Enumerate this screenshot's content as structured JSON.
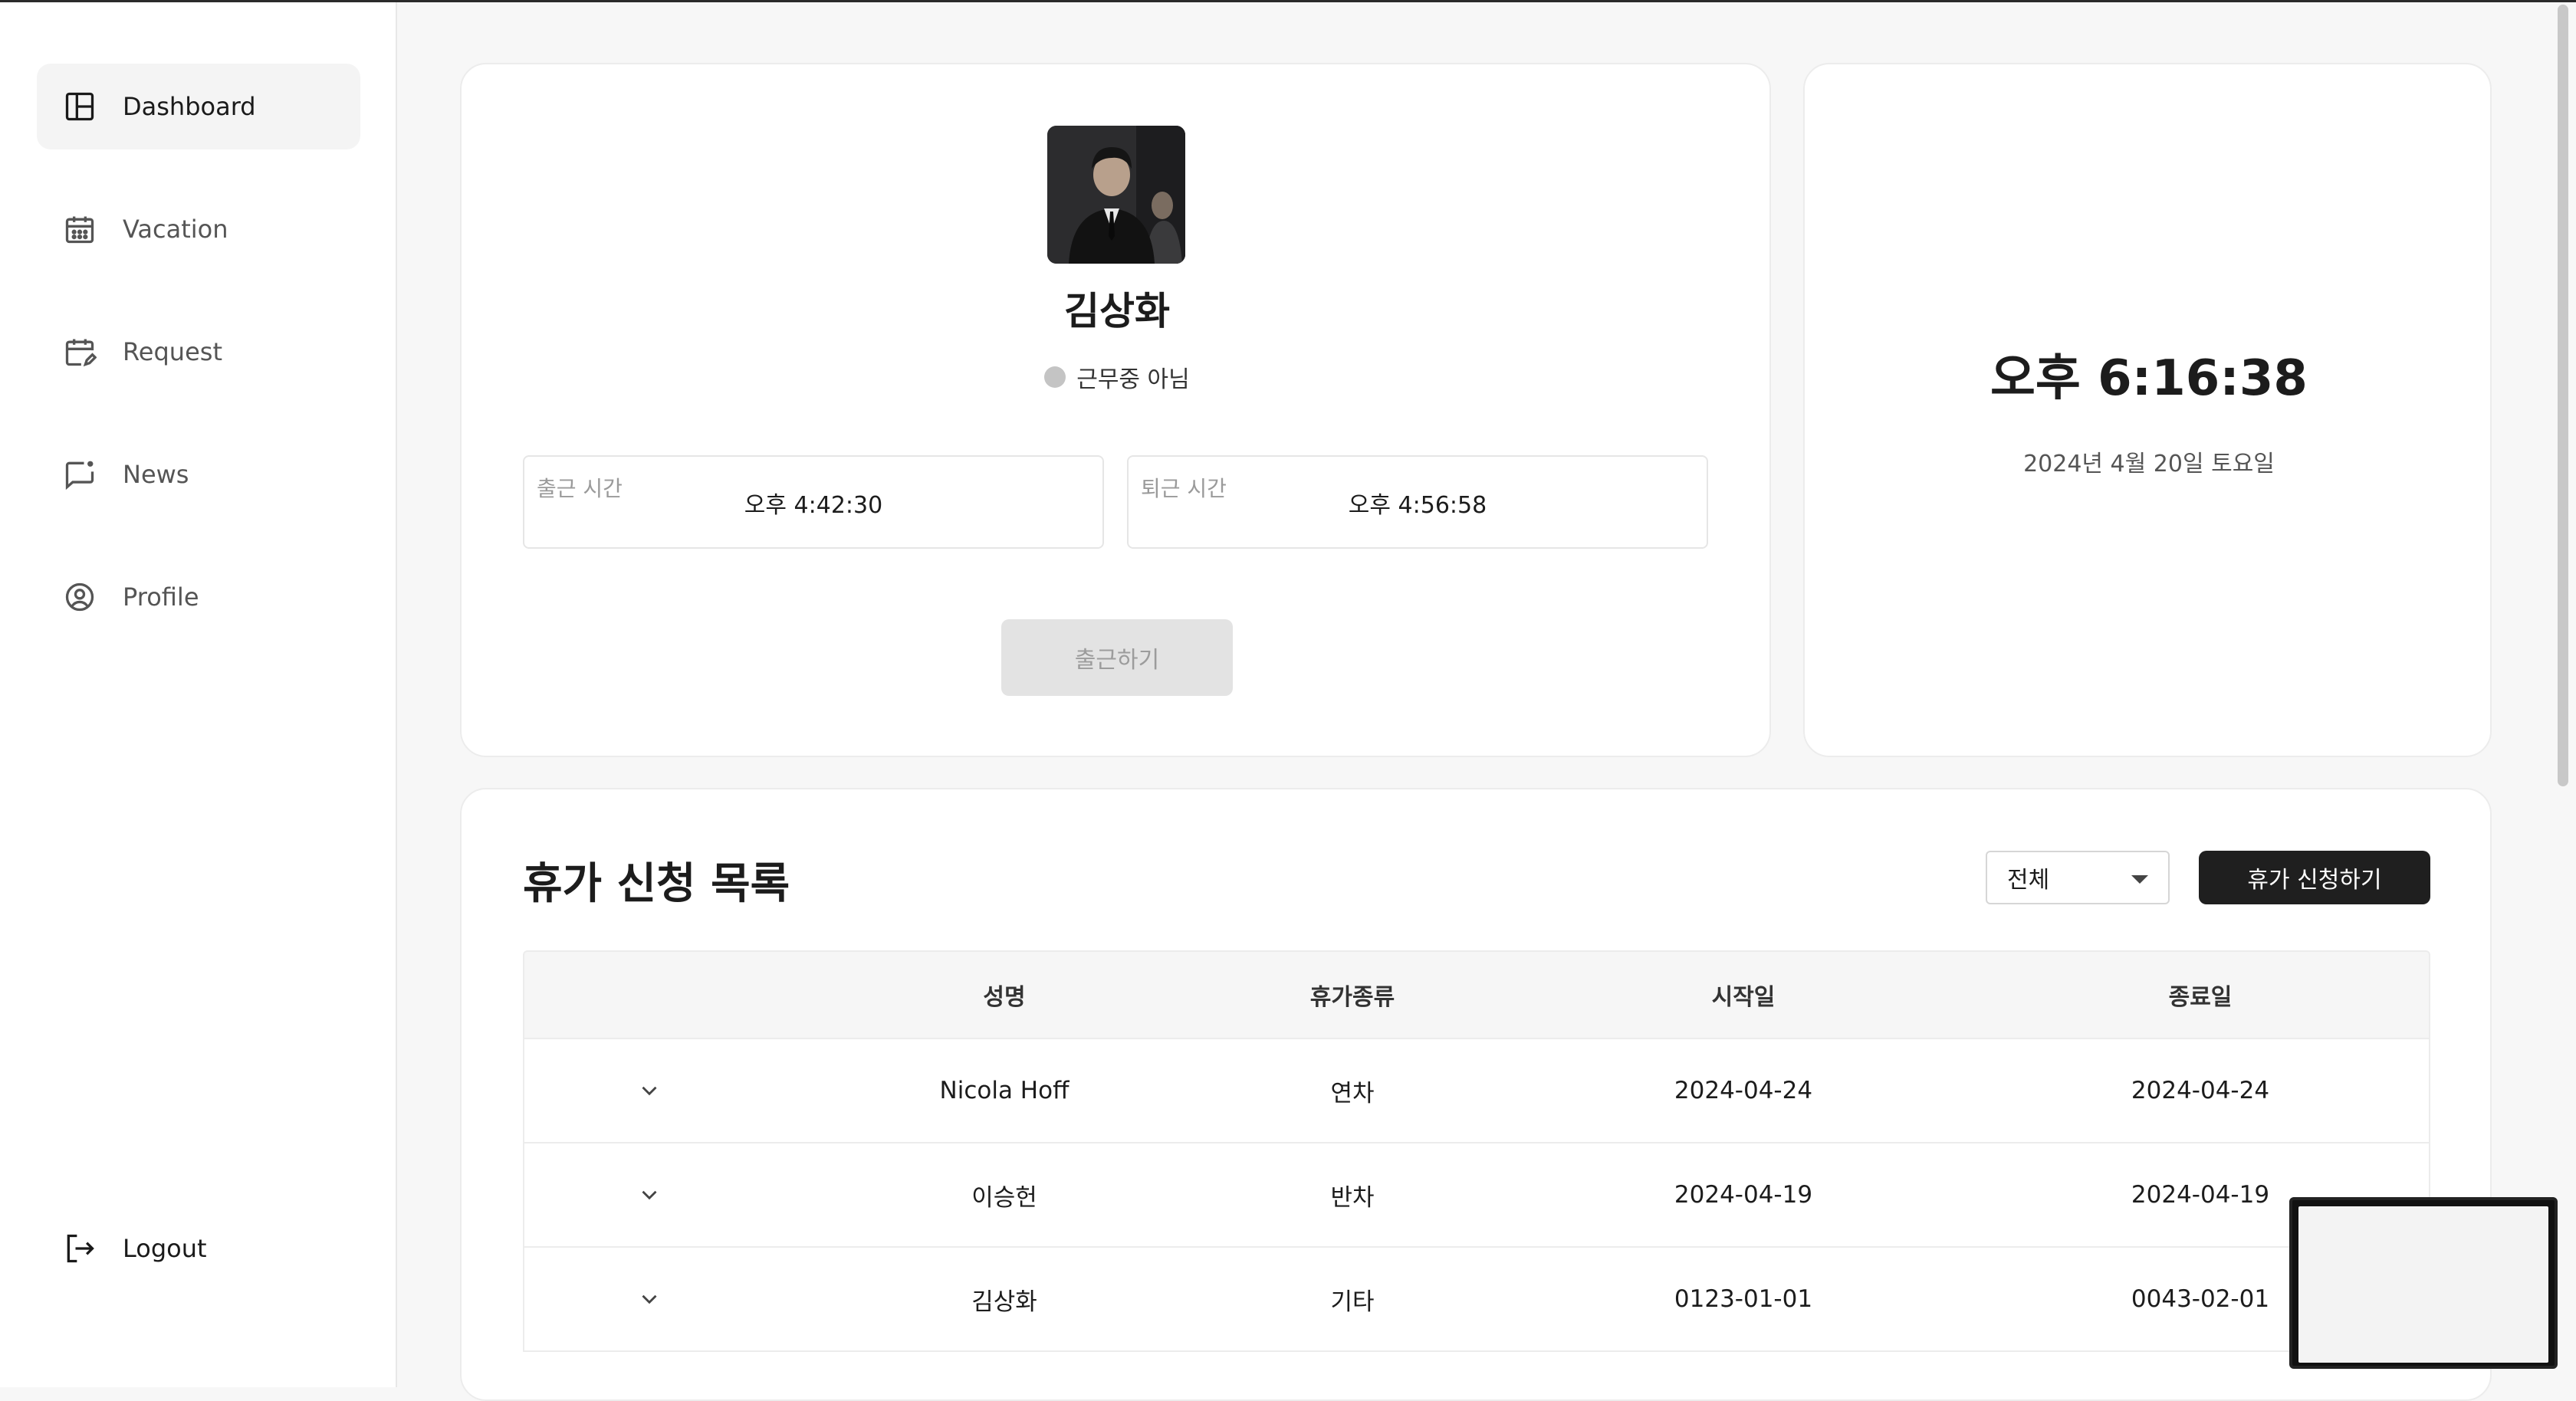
{
  "sidebar": {
    "items": [
      {
        "label": "Dashboard",
        "icon": "dashboard-icon",
        "active": true
      },
      {
        "label": "Vacation",
        "icon": "calendar-icon",
        "active": false
      },
      {
        "label": "Request",
        "icon": "calendar-edit-icon",
        "active": false
      },
      {
        "label": "News",
        "icon": "message-notification-icon",
        "active": false
      },
      {
        "label": "Profile",
        "icon": "user-circle-icon",
        "active": false
      }
    ],
    "logout_label": "Logout"
  },
  "profile": {
    "name": "김상화",
    "status": "근무중 아님",
    "status_color": "#c4c4c4",
    "checkin_label": "출근 시간",
    "checkin_time": "오후 4:42:30",
    "checkout_label": "퇴근 시간",
    "checkout_time": "오후 4:56:58",
    "checkin_button": "출근하기"
  },
  "clock": {
    "time": "오후 6:16:38",
    "date": "2024년 4월 20일 토요일"
  },
  "vacation_list": {
    "title": "휴가 신청 목록",
    "filter_value": "전체",
    "request_button": "휴가 신청하기",
    "columns": [
      "",
      "성명",
      "휴가종류",
      "시작일",
      "종료일"
    ],
    "rows": [
      {
        "name": "Nicola Hoff",
        "type": "연차",
        "start": "2024-04-24",
        "end": "2024-04-24"
      },
      {
        "name": "이승헌",
        "type": "반차",
        "start": "2024-04-19",
        "end": "2024-04-19"
      },
      {
        "name": "김상화",
        "type": "기타",
        "start": "0123-01-01",
        "end": "0043-02-01"
      }
    ]
  },
  "colors": {
    "primary_button": "#1f1f1f",
    "disabled_button": "#e3e3e3",
    "background": "#f7f7f7"
  }
}
